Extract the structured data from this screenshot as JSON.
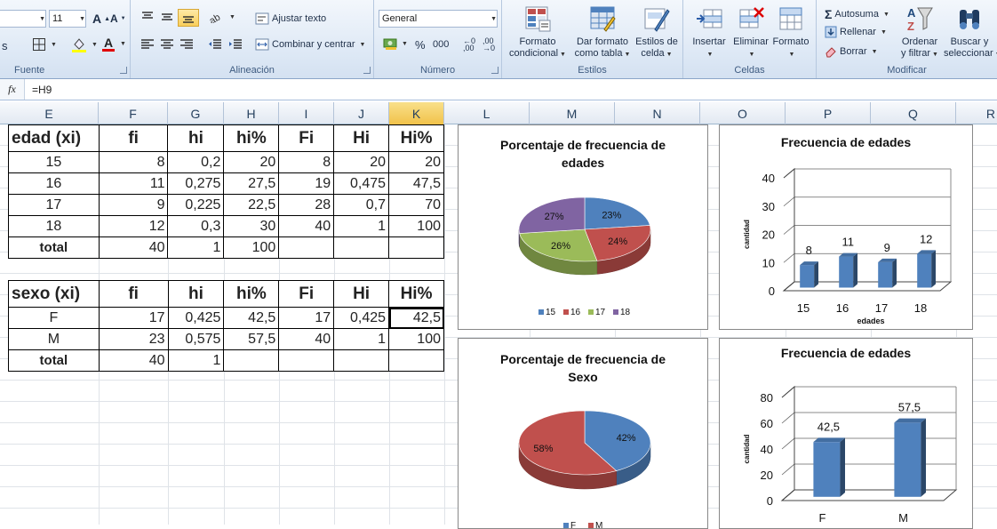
{
  "ribbon": {
    "font": {
      "size": "11",
      "grow_icon": "font-grow-icon",
      "shrink_icon": "font-shrink-icon",
      "border_icon": "border-icon",
      "fill_icon": "fill-color-icon",
      "fontcolor_icon": "font-color-icon",
      "group_label": "Fuente"
    },
    "alignment": {
      "wrap_text": "Ajustar texto",
      "merge_center": "Combinar y centrar",
      "group_label": "Alineación"
    },
    "number": {
      "format": "General",
      "percent": "%",
      "thousands": "000",
      "group_label": "Número"
    },
    "styles": {
      "conditional": [
        "Formato",
        "condicional"
      ],
      "as_table": [
        "Dar formato",
        "como tabla"
      ],
      "cell_styles": [
        "Estilos de",
        "celda"
      ],
      "group_label": "Estilos"
    },
    "cells": {
      "insert": "Insertar",
      "delete": "Eliminar",
      "format": "Formato",
      "group_label": "Celdas"
    },
    "editing": {
      "autosum": "Autosuma",
      "fill": "Rellenar",
      "clear": "Borrar",
      "sort": [
        "Ordenar",
        "y filtrar"
      ],
      "find": [
        "Buscar y",
        "seleccionar"
      ],
      "group_label": "Modificar"
    }
  },
  "formula_bar": {
    "fx": "fx",
    "content": "=H9"
  },
  "columns": [
    "E",
    "F",
    "G",
    "H",
    "I",
    "J",
    "K",
    "L",
    "M",
    "N",
    "O",
    "P",
    "Q",
    "R"
  ],
  "active_column": "K",
  "table_edad": {
    "headers": [
      "edad (xi)",
      "fi",
      "hi",
      "hi%",
      "Fi",
      "Hi",
      "Hi%"
    ],
    "rows": [
      [
        "15",
        "8",
        "0,2",
        "20",
        "8",
        "20",
        "20"
      ],
      [
        "16",
        "11",
        "0,275",
        "27,5",
        "19",
        "0,475",
        "47,5"
      ],
      [
        "17",
        "9",
        "0,225",
        "22,5",
        "28",
        "0,7",
        "70"
      ],
      [
        "18",
        "12",
        "0,3",
        "30",
        "40",
        "1",
        "100"
      ]
    ],
    "total": [
      "total",
      "40",
      "1",
      "100",
      "",
      "",
      ""
    ]
  },
  "table_sexo": {
    "headers": [
      "sexo (xi)",
      "fi",
      "hi",
      "hi%",
      "Fi",
      "Hi",
      "Hi%"
    ],
    "rows": [
      [
        "F",
        "17",
        "0,425",
        "42,5",
        "17",
        "0,425",
        "42,5"
      ],
      [
        "M",
        "23",
        "0,575",
        "57,5",
        "40",
        "1",
        "100"
      ]
    ],
    "total": [
      "total",
      "40",
      "1",
      "",
      "",
      "",
      ""
    ]
  },
  "chart_data": [
    {
      "type": "pie",
      "title": "Porcentaje de frecuencia de edades",
      "categories": [
        "15",
        "16",
        "17",
        "18"
      ],
      "values": [
        23,
        24,
        26,
        27
      ],
      "labels": [
        "23%",
        "24%",
        "26%",
        "27%"
      ],
      "colors": [
        "#4f81bd",
        "#c0504d",
        "#9bbb59",
        "#8064a2"
      ],
      "legend": "bottom"
    },
    {
      "type": "bar",
      "title": "Frecuencia de edades",
      "categories": [
        "15",
        "16",
        "17",
        "18"
      ],
      "values": [
        8,
        11,
        9,
        12
      ],
      "xlabel": "edades",
      "ylabel": "cantidad",
      "ylim": [
        0,
        40
      ],
      "yticks": [
        0,
        10,
        20,
        30,
        40
      ],
      "color": "#4f81bd"
    },
    {
      "type": "pie",
      "title": "Porcentaje de frecuencia de Sexo",
      "categories": [
        "F",
        "M"
      ],
      "values": [
        42,
        58
      ],
      "labels": [
        "42%",
        "58%"
      ],
      "colors": [
        "#4f81bd",
        "#c0504d"
      ],
      "legend": "bottom"
    },
    {
      "type": "bar",
      "title": "Frecuencia de edades",
      "categories": [
        "F",
        "M"
      ],
      "values": [
        42.5,
        57.5
      ],
      "value_labels": [
        "42,5",
        "57,5"
      ],
      "ylabel": "cantidad",
      "ylim": [
        0,
        80
      ],
      "yticks": [
        0,
        20,
        40,
        60,
        80
      ],
      "color": "#4f81bd"
    }
  ]
}
